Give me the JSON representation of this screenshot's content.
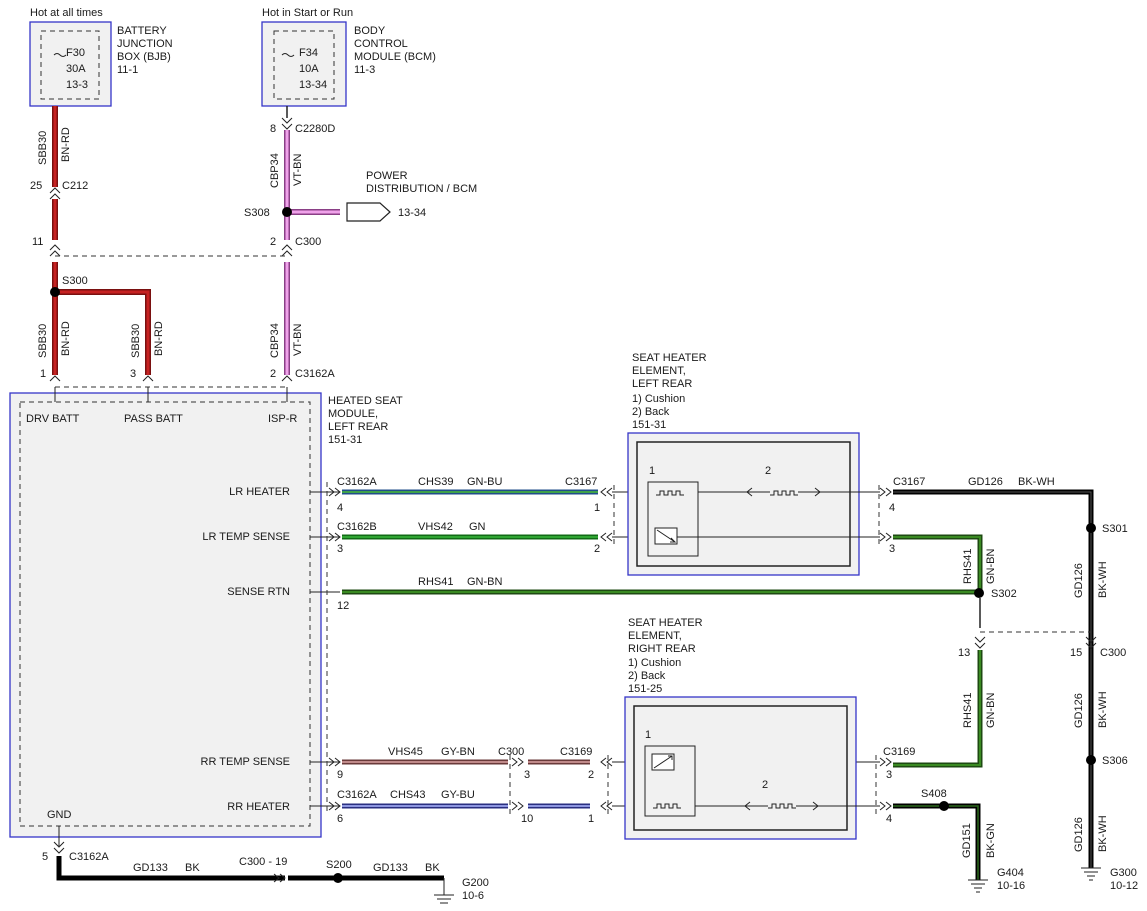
{
  "colors": {
    "BN-RD": "#b51d1d",
    "VT-BN": "#d97bd1",
    "GN-BU": "#2f6fb3",
    "GN": "#1e8b22",
    "GN-BN": "#2e6b1a",
    "GY-BN": "#a86a6a",
    "GY-BU": "#4a5fc4",
    "BK": "#000000",
    "BK-WH": "#000000",
    "frame": "#3535c8"
  },
  "power": {
    "bjb": {
      "header": "Hot at all times",
      "fuse": "F30",
      "amps": "30A",
      "ref": "13-3",
      "title": [
        "BATTERY",
        "JUNCTION",
        "BOX (BJB)"
      ],
      "page": "11-1"
    },
    "bcm": {
      "header": "Hot in Start or Run",
      "fuse": "F34",
      "amps": "10A",
      "ref": "13-34",
      "title": [
        "BODY",
        "CONTROL",
        "MODULE (BCM)"
      ],
      "page": "11-3"
    }
  },
  "power_dist": {
    "title": [
      "POWER",
      "DISTRIBUTION / BCM"
    ],
    "ref": "13-34",
    "splice": "S308"
  },
  "circuits": {
    "sbb30": "SBB30",
    "bnrd": "BN-RD",
    "cbp34": "CBP34",
    "vtbn": "VT-BN"
  },
  "pins": {
    "p25": "25",
    "p11": "11",
    "p8": "8",
    "p2": "2",
    "p1": "1",
    "p3": "3",
    "p4": "4",
    "p12": "12",
    "p9": "9",
    "p6": "6",
    "p10": "10",
    "p13": "13",
    "p15": "15",
    "p5": "5"
  },
  "connectors": {
    "c212": "C212",
    "c2280d": "C2280D",
    "c300": "C300",
    "c3162a": "C3162A",
    "c3162b": "C3162B",
    "c3167": "C3167",
    "c3169": "C3169",
    "c300_19": "C300  -  19"
  },
  "splices": {
    "s300": "S300",
    "s301": "S301",
    "s302": "S302",
    "s306": "S306",
    "s408": "S408",
    "s200": "S200"
  },
  "module": {
    "title": [
      "HEATED SEAT",
      "MODULE,",
      "LEFT REAR"
    ],
    "page": "151-31",
    "drv_batt": "DRV BATT",
    "pass_batt": "PASS BATT",
    "isp_r": "ISP-R",
    "lr_heater": "LR HEATER",
    "lr_temp": "LR TEMP SENSE",
    "sense_rtn": "SENSE RTN",
    "rr_temp": "RR TEMP SENSE",
    "rr_heater": "RR HEATER",
    "gnd": "GND"
  },
  "wires": {
    "chs39": "CHS39",
    "gnbu": "GN-BU",
    "vhs42": "VHS42",
    "gn": "GN",
    "rhs41": "RHS41",
    "gnbn": "GN-BN",
    "vhs45": "VHS45",
    "gybn": "GY-BN",
    "chs43": "CHS43",
    "gybu": "GY-BU",
    "gd126": "GD126",
    "bkwh": "BK-WH",
    "gd151": "GD151",
    "bkgn": "BK-GN",
    "gd133": "GD133",
    "bk": "BK"
  },
  "heater_left": {
    "title": [
      "SEAT HEATER",
      "ELEMENT,",
      "LEFT REAR"
    ],
    "items": [
      "1) Cushion",
      "2) Back"
    ],
    "page": "151-31",
    "n1": "1",
    "n2": "2"
  },
  "heater_right": {
    "title": [
      "SEAT HEATER",
      "ELEMENT,",
      "RIGHT REAR"
    ],
    "items": [
      "1) Cushion",
      "2) Back"
    ],
    "page": "151-25",
    "n1": "1",
    "n2": "2"
  },
  "grounds": {
    "g200": "G200",
    "g200_ref": "10-6",
    "g404": "G404",
    "g404_ref": "10-16",
    "g300": "G300",
    "g300_ref": "10-12"
  }
}
